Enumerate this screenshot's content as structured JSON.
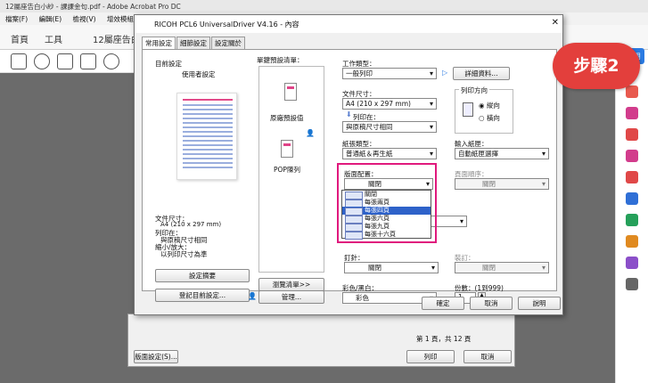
{
  "acrobat": {
    "title": "12屬座告白小紗 - 課課金句.pdf - Adobe Acrobat Pro DC",
    "menu": [
      "檔案(F)",
      "編輯(E)",
      "檢視(V)",
      "增效模組(P)",
      "視"
    ],
    "tabs": [
      "首頁",
      "工具",
      "12屬座告白"
    ],
    "share_label": "共用"
  },
  "page_setup": {
    "page_setup_button": "版面設定(S)...",
    "page_count": "第 1 頁，共 12 頁",
    "print_button": "列印",
    "cancel_button": "取消"
  },
  "dialog": {
    "title": "RICOH PCL6 UniversalDriver V4.16 - 內容",
    "tabs": [
      "常用設定",
      "細節設定",
      "設定關於"
    ],
    "current_settings_label": "目前設定",
    "user_settings": "使用者設定",
    "summary": [
      "文件尺寸：",
      "A4 (210 x 297 mm)",
      "列印在：",
      "與原稿尺寸相同",
      "縮小/放大：",
      "以列印尺寸為準"
    ],
    "settings_summary_button": "設定摘要",
    "register_button": "登記目前設定...",
    "one_click_label": "單鍵預設清單：",
    "preset_default": "原廠預設值",
    "preset_pop": "POP陳列",
    "browse_button": "瀏覽清單>>",
    "manage_button": "管理...",
    "job_type_label": "工作類型：",
    "job_type_value": "一般列印",
    "details_button": "詳細資料...",
    "doc_size_label": "文件尺寸：",
    "doc_size_value": "A4 (210 x 297 mm)",
    "print_on_label": "列印在：",
    "print_on_value": "與原稿尺寸相同",
    "orientation_label": "列印方向",
    "portrait": "縱向",
    "landscape": "橫向",
    "paper_type_label": "紙張類型：",
    "paper_type_value": "普通紙＆再生紙",
    "input_tray_label": "輸入紙匣：",
    "input_tray_value": "自動紙匣選擇",
    "layout_label": "版面配置：",
    "layout_value": "關閉",
    "layout_options": [
      "關閉",
      "每張兩頁",
      "每張四頁",
      "每張六頁",
      "每張九頁",
      "每張十六頁"
    ],
    "layout_selected_index": 2,
    "page_order_label": "頁面順序：",
    "page_order_value": "關閉",
    "duplex_label": "裝訂：",
    "duplex_value": "關閉",
    "staple_label": "釘針：",
    "staple_value": "關閉",
    "color_label": "彩色/黑白：",
    "color_value": "彩色",
    "copies_label": "份數：(1到999)",
    "copies_value": "1",
    "ok_button": "確定",
    "cancel_button": "取消",
    "help_button": "說明"
  },
  "badge": {
    "text": "步驟2",
    "color": "#e33f3c"
  },
  "colors": {
    "highlight": "#e0197d",
    "selection": "#2e62c9"
  }
}
